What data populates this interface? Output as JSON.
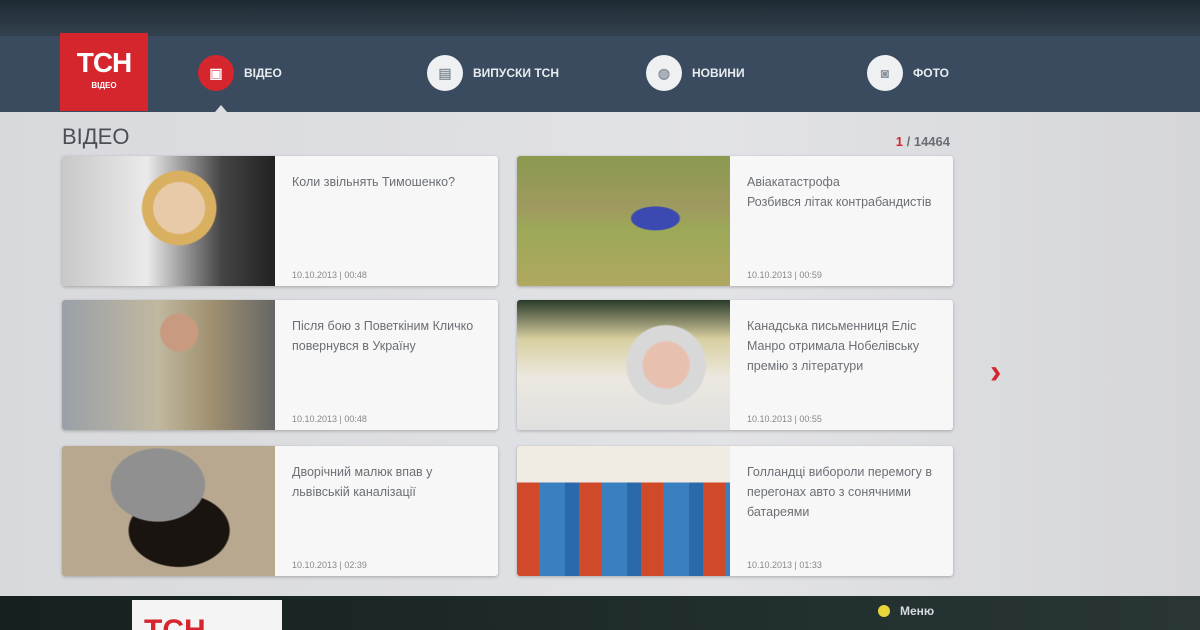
{
  "brand": {
    "logo_main": "ТСН",
    "logo_sub": "ВІДЕО",
    "accent": "#d4262c"
  },
  "nav": [
    {
      "label": "ВІДЕО",
      "icon": "video-icon",
      "active": true
    },
    {
      "label": "ВИПУСКИ ТСН",
      "icon": "episodes-icon"
    },
    {
      "label": "НОВИНИ",
      "icon": "news-icon"
    },
    {
      "label": "ФОТО",
      "icon": "camera-icon"
    }
  ],
  "page": {
    "title": "ВІДЕО",
    "counter_current": "1",
    "counter_total": " / 14464"
  },
  "cards": [
    {
      "title1": "Коли звільнять Тимошенко?",
      "title2": "",
      "date": "10.10.2013 | 00:48"
    },
    {
      "title1": "Авіакатастрофа",
      "title2": "Розбився літак контрабандистів",
      "date": "10.10.2013 | 00:59"
    },
    {
      "title1": "Після бою з Поветкіним Кличко повернувся в Україну",
      "title2": "",
      "date": "10.10.2013 | 00:48"
    },
    {
      "title1": "Канадська письменниця Еліс Манро отримала Нобелівську премію з літератури",
      "title2": "",
      "date": "10.10.2013 | 00:55"
    },
    {
      "title1": "Дворічний малюк впав у львівській каналізації",
      "title2": "",
      "date": "10.10.2013 | 02:39"
    },
    {
      "title1": "Голландці вибороли перемогу в перегонах авто з сонячними батареями",
      "title2": "",
      "date": "10.10.2013 | 01:33"
    }
  ],
  "footer": {
    "logo": "ТСН",
    "menu_label": "Меню",
    "menu_button_color": "#e8d53a"
  }
}
